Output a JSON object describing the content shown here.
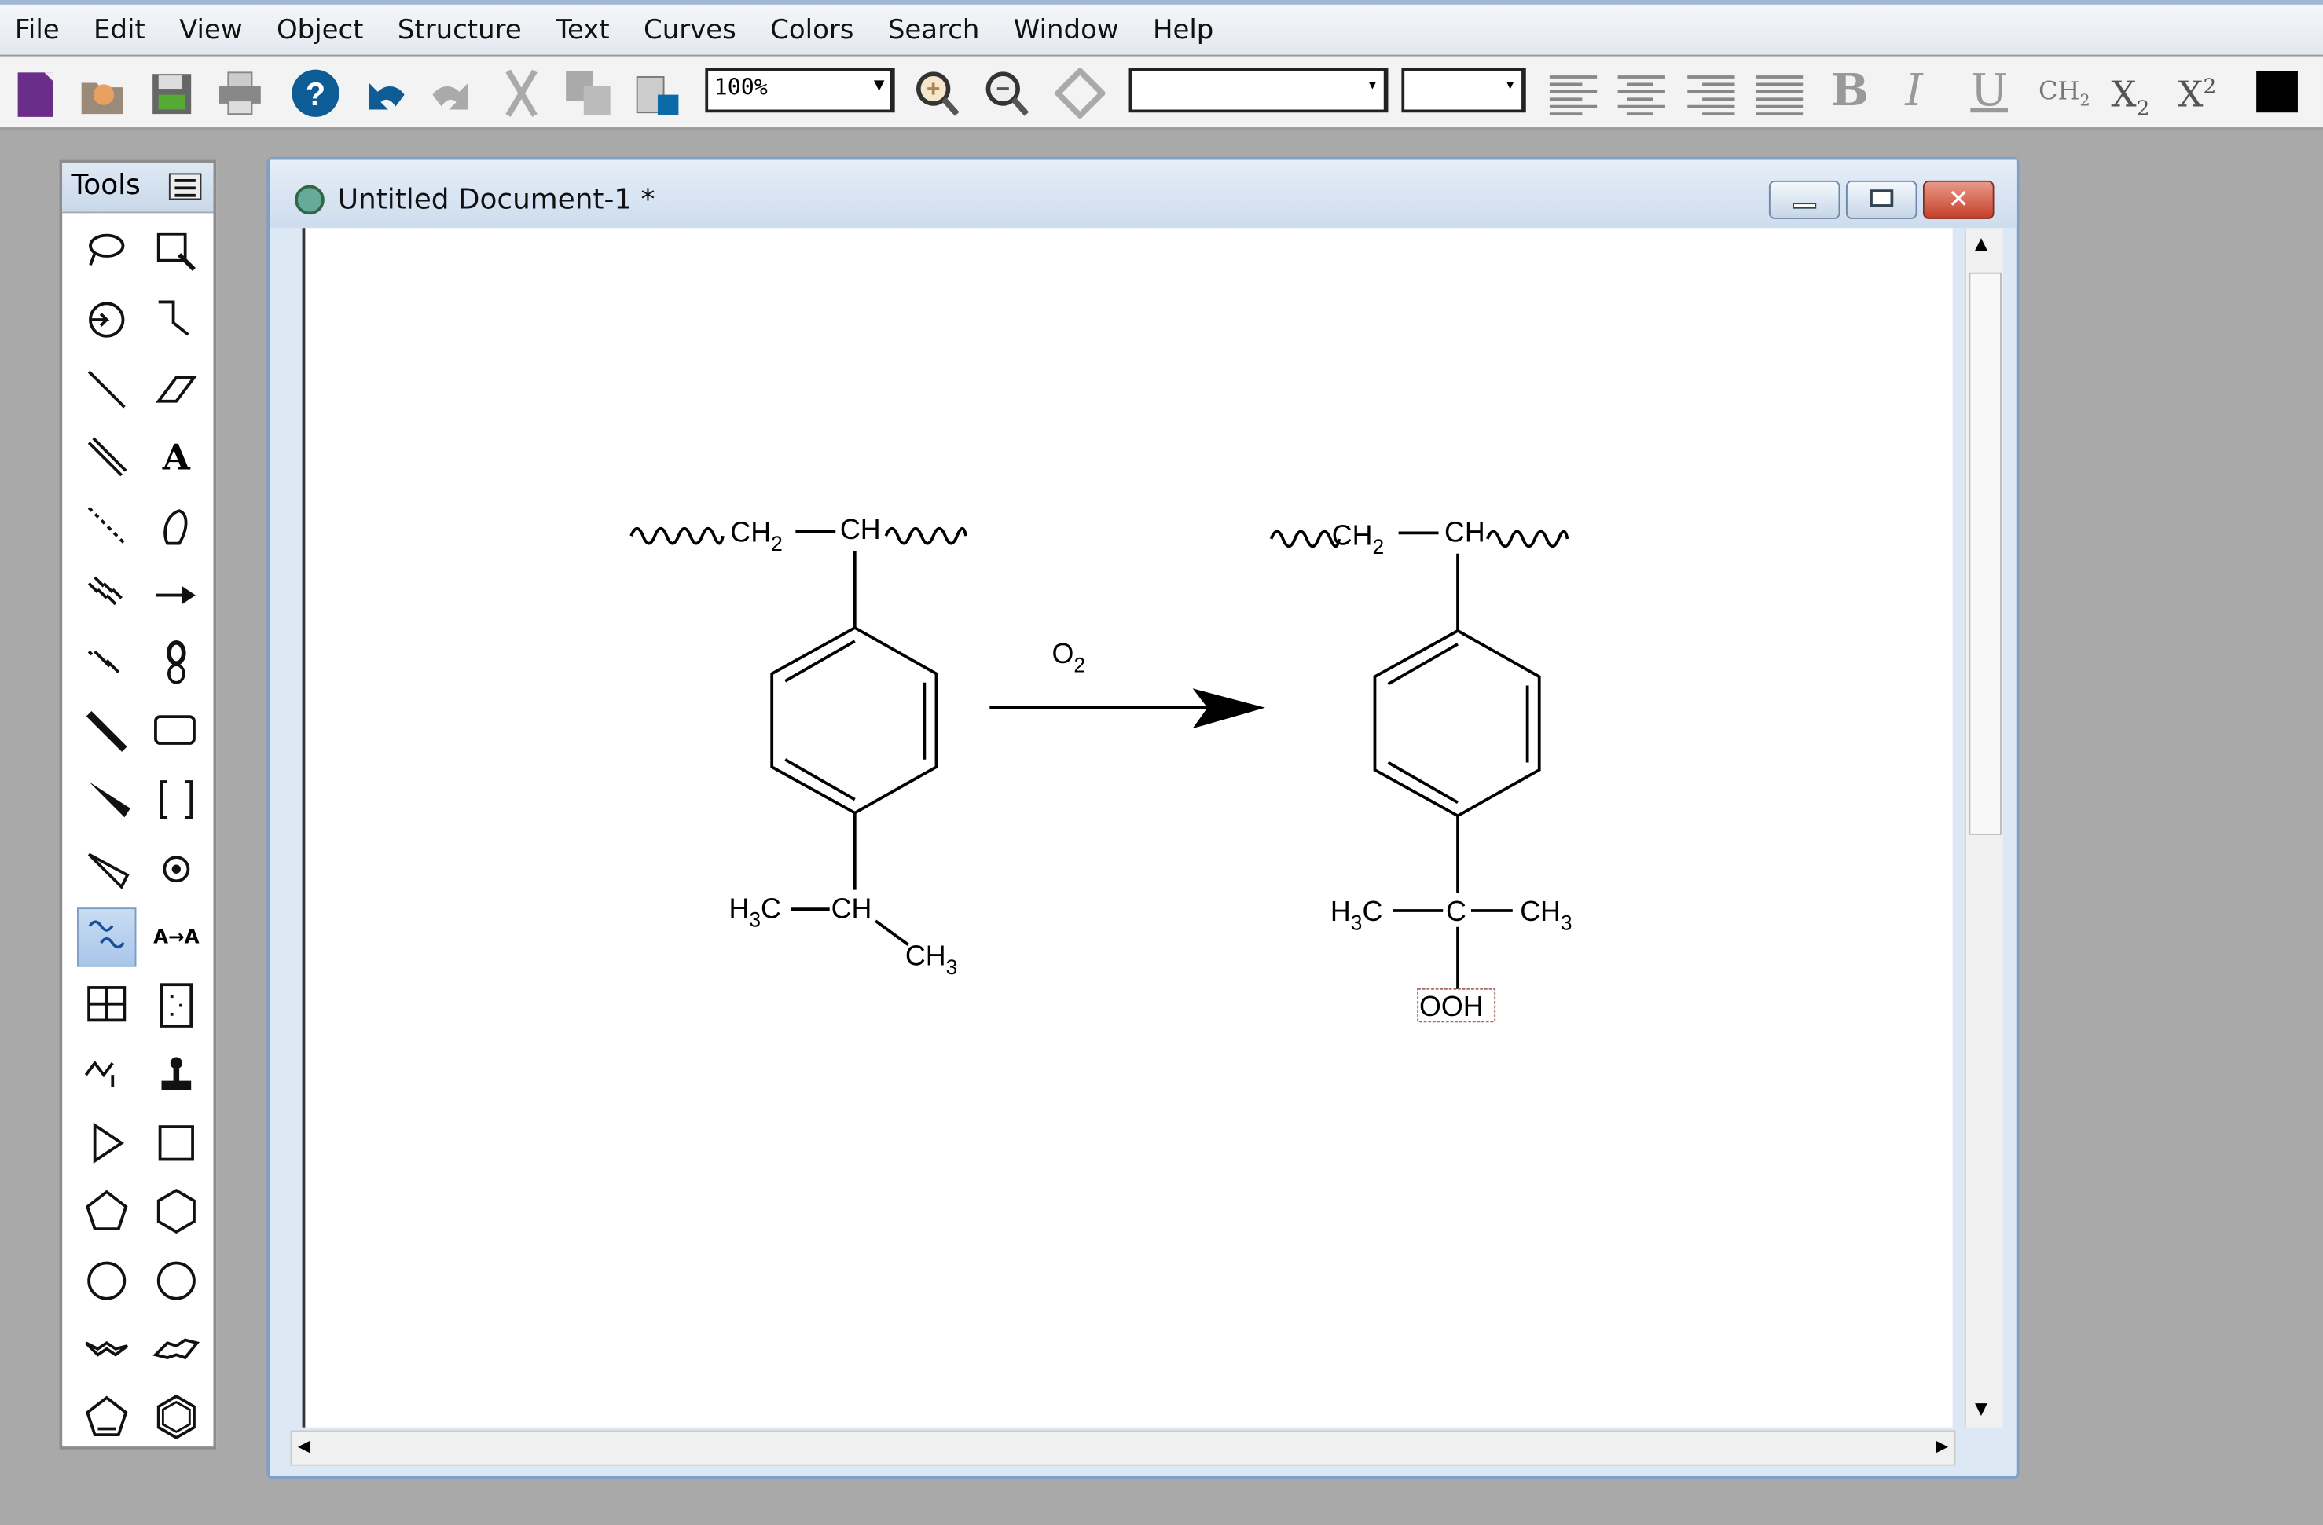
{
  "menu": [
    "File",
    "Edit",
    "View",
    "Object",
    "Structure",
    "Text",
    "Curves",
    "Colors",
    "Search",
    "Window",
    "Help"
  ],
  "toolbar": {
    "zoom_value": "100%",
    "font_value": "",
    "size_value": "",
    "bold_label": "B",
    "italic_label": "I",
    "underline_label": "U",
    "formula_label": "CH2",
    "subscript_label": "X2",
    "superscript_label": "X2",
    "color": "#000000",
    "icons": [
      "new-document-icon",
      "open-icon",
      "save-icon",
      "print-icon",
      "help-icon",
      "undo-icon",
      "redo-icon",
      "cut-icon",
      "copy-icon",
      "paste-icon",
      "zoom-in-icon",
      "zoom-out-icon",
      "show-center-icon",
      "align-left-icon",
      "align-center-icon",
      "align-right-icon",
      "justify-icon"
    ]
  },
  "palette": {
    "title": "Tools",
    "text_tool_label": "A",
    "query_tool_label": "A→A",
    "selected_tool": "wavy-bond",
    "tools": [
      "lasso",
      "marquee",
      "structure-perspective",
      "acyclic-chain",
      "solid-bond",
      "eraser",
      "double-bond",
      "text",
      "dashed-bond",
      "pen",
      "hashed-bond",
      "arrow",
      "hashed-wedged-bond",
      "orbital",
      "bold-bond",
      "drawing-elements",
      "wedged-bond",
      "brackets",
      "hollow-wedged-bond",
      "chemical-symbols",
      "wavy-bond",
      "query",
      "table",
      "tlc-plate",
      "multi-center-attachment",
      "templates",
      "triangle",
      "square",
      "pentagon",
      "hexagon",
      "cyclohexane",
      "circle",
      "chair-1",
      "chair-2",
      "cyclopentadiene",
      "benzene"
    ]
  },
  "document": {
    "title": "Untitled Document-1 *",
    "reactant": {
      "top_left": "CH2",
      "top_right": "CH",
      "bottom_left": "H3C",
      "bottom_center": "CH",
      "bottom_branch": "CH3"
    },
    "reagent": "O2",
    "product": {
      "top_left": "CH2",
      "top_right": "CH",
      "bottom_left": "H3C",
      "bottom_center": "C",
      "bottom_right": "CH3",
      "bottom_down": "OOH"
    }
  }
}
